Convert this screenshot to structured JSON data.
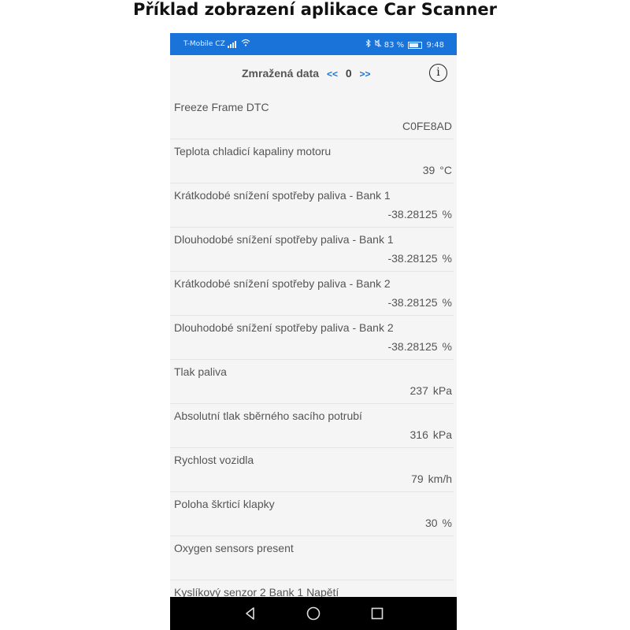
{
  "caption": "Příklad zobrazení aplikace Car Scanner",
  "status_bar": {
    "carrier": "T-Mobile CZ",
    "battery": "83 %",
    "time": "9:48"
  },
  "header": {
    "title": "Zmražená data",
    "prev": "<<",
    "frame": "0",
    "next": ">>",
    "info": "i"
  },
  "items": [
    {
      "label": "Freeze Frame DTC",
      "value": "C0FE8AD",
      "unit": ""
    },
    {
      "label": "Teplota chladicí kapaliny motoru",
      "value": "39",
      "unit": "°C"
    },
    {
      "label": "Krátkodobé snížení spotřeby paliva - Bank 1",
      "value": "-38.28125",
      "unit": "%"
    },
    {
      "label": "Dlouhodobé snížení spotřeby paliva - Bank 1",
      "value": "-38.28125",
      "unit": "%"
    },
    {
      "label": "Krátkodobé snížení spotřeby paliva - Bank 2",
      "value": "-38.28125",
      "unit": "%"
    },
    {
      "label": "Dlouhodobé snížení spotřeby paliva - Bank 2",
      "value": "-38.28125",
      "unit": "%"
    },
    {
      "label": "Tlak paliva",
      "value": "237",
      "unit": "kPa"
    },
    {
      "label": "Absolutní tlak sběrného sacího potrubí",
      "value": "316",
      "unit": "kPa"
    },
    {
      "label": "Rychlost vozidla",
      "value": "79",
      "unit": "km/h"
    },
    {
      "label": "Poloha škrticí klapky",
      "value": "30",
      "unit": "%"
    },
    {
      "label": "Oxygen sensors present",
      "value": "",
      "unit": ""
    },
    {
      "label": "Kyslíkový senzor 2 Bank 1 Napětí",
      "value": "",
      "unit": ""
    }
  ],
  "icons": {
    "bluetooth": "bluetooth-icon",
    "mute": "mute-icon",
    "back": "back-icon",
    "home": "home-icon",
    "recents": "recents-icon"
  },
  "colors": {
    "accent": "#1a73d8",
    "navbar": "#000000",
    "background": "#f5f5f5"
  }
}
